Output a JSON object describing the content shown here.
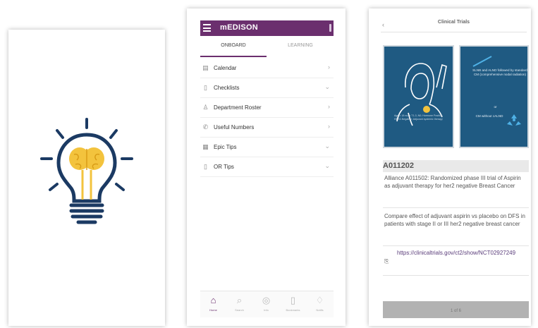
{
  "screen2": {
    "app_title": "mEDISON",
    "tabs": [
      "ONBOARD",
      "LEARNING"
    ],
    "menu": [
      {
        "icon": "calendar-icon",
        "label": "Calendar",
        "chevron": "›"
      },
      {
        "icon": "checklist-icon",
        "label": "Checklists",
        "chevron": "⌄"
      },
      {
        "icon": "person-icon",
        "label": "Department Roster",
        "chevron": "›"
      },
      {
        "icon": "phone-icon",
        "label": "Useful Numbers",
        "chevron": "›"
      },
      {
        "icon": "document-icon",
        "label": "Epic Tips",
        "chevron": "⌄"
      },
      {
        "icon": "book-icon",
        "label": "OR Tips",
        "chevron": "⌄"
      }
    ],
    "bottom_nav": [
      {
        "icon": "home-icon",
        "label": "Home"
      },
      {
        "icon": "search-icon",
        "label": "Search"
      },
      {
        "icon": "info-icon",
        "label": "Info"
      },
      {
        "icon": "bookmark-icon",
        "label": "Bookmarks"
      },
      {
        "icon": "notification-icon",
        "label": "Notifs"
      }
    ]
  },
  "screen3": {
    "header_title": "Clinical Trials",
    "back_glyph": "‹",
    "card1_text": "Age ≥ 18 no; ≥ T1-3, N0; Hormone Positive HER2-Negative; Adjuvant systemic therapy",
    "card2_text": "SLNB and ALND followed by standard CM (comprehensive nodal radiation)",
    "card2_or": "or",
    "card2_bottom": "CM without cALND",
    "trial_id": "A011202",
    "paragraph1": "Alliance A011502: Randomized phase III trial of Aspirin as adjuvant therapy for her2 negative Breast Cancer",
    "paragraph2": "Compare effect of adjuvant aspirin vs placebo on DFS in patients with stage II or III her2 negative breast cancer",
    "link": "https://clinicaltrials.gov/ct2/show/NCT02927249",
    "pager": "1 of 6"
  },
  "colors": {
    "brand_purple": "#6b2f6e",
    "card_blue": "#1f5a82",
    "bulb_blue": "#1b3a63",
    "brain_yellow": "#f3c33d"
  },
  "icons": {
    "splash": "lightbulb-brain-icon",
    "link": "link-icon",
    "hamburger": "hamburger-icon",
    "more": "more-icon"
  }
}
